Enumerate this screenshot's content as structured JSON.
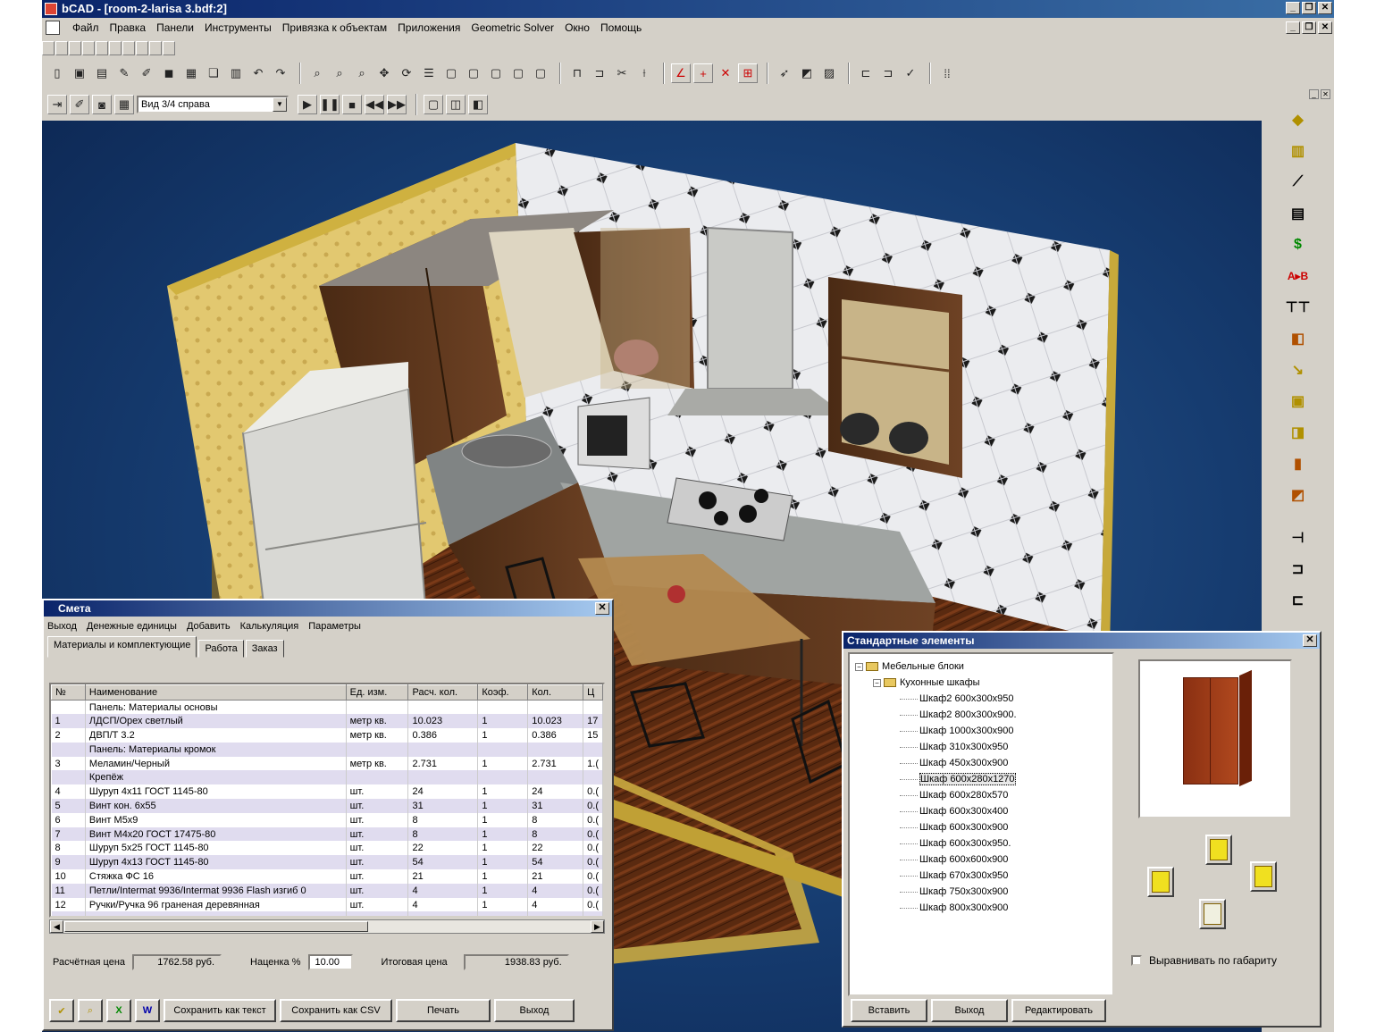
{
  "app": {
    "title": "bCAD - [room-2-larisa 3.bdf:2]",
    "menu": [
      "Файл",
      "Правка",
      "Панели",
      "Инструменты",
      "Привязка к объектам",
      "Приложения",
      "Geometric Solver",
      "Окно",
      "Помощь"
    ]
  },
  "view_toolbar": {
    "view_combo": "Вид 3/4 справа"
  },
  "estimate": {
    "title": "Смета",
    "menu": [
      "Выход",
      "Денежные единицы",
      "Добавить",
      "Калькуляция",
      "Параметры"
    ],
    "tabs": [
      "Материалы и комплектующие",
      "Работа",
      "Заказ"
    ],
    "columns": [
      "№",
      "Наименование",
      "Ед. изм.",
      "Расч. кол.",
      "Коэф.",
      "Кол.",
      "Ц"
    ],
    "rows": [
      {
        "n": "",
        "name": "Панель: Материалы основы",
        "unit": "",
        "calc": "",
        "coef": "",
        "qty": "",
        "price": "",
        "kind": "grp"
      },
      {
        "n": "1",
        "name": "ЛДСП/Орех светлый",
        "unit": "метр кв.",
        "calc": "10.023",
        "coef": "1",
        "qty": "10.023",
        "price": "17",
        "kind": "alt"
      },
      {
        "n": "2",
        "name": "ДВП/Т 3.2",
        "unit": "метр кв.",
        "calc": "0.386",
        "coef": "1",
        "qty": "0.386",
        "price": "15",
        "kind": ""
      },
      {
        "n": "",
        "name": "Панель: Материалы кромок",
        "unit": "",
        "calc": "",
        "coef": "",
        "qty": "",
        "price": "",
        "kind": "alt"
      },
      {
        "n": "3",
        "name": "Меламин/Черный",
        "unit": "метр кв.",
        "calc": "2.731",
        "coef": "1",
        "qty": "2.731",
        "price": "1.(",
        "kind": ""
      },
      {
        "n": "",
        "name": "Крепёж",
        "unit": "",
        "calc": "",
        "coef": "",
        "qty": "",
        "price": "",
        "kind": "alt"
      },
      {
        "n": "4",
        "name": "Шуруп 4x11 ГОСТ 1145-80",
        "unit": "шт.",
        "calc": "24",
        "coef": "1",
        "qty": "24",
        "price": "0.(",
        "kind": ""
      },
      {
        "n": "5",
        "name": "Винт кон. 6x55",
        "unit": "шт.",
        "calc": "31",
        "coef": "1",
        "qty": "31",
        "price": "0.(",
        "kind": "alt"
      },
      {
        "n": "6",
        "name": "Винт М5x9",
        "unit": "шт.",
        "calc": "8",
        "coef": "1",
        "qty": "8",
        "price": "0.(",
        "kind": ""
      },
      {
        "n": "7",
        "name": "Винт М4x20 ГОСТ 17475-80",
        "unit": "шт.",
        "calc": "8",
        "coef": "1",
        "qty": "8",
        "price": "0.(",
        "kind": "alt"
      },
      {
        "n": "8",
        "name": "Шуруп 5x25 ГОСТ 1145-80",
        "unit": "шт.",
        "calc": "22",
        "coef": "1",
        "qty": "22",
        "price": "0.(",
        "kind": ""
      },
      {
        "n": "9",
        "name": "Шуруп 4x13 ГОСТ 1145-80",
        "unit": "шт.",
        "calc": "54",
        "coef": "1",
        "qty": "54",
        "price": "0.(",
        "kind": "alt"
      },
      {
        "n": "10",
        "name": "Стяжка ФС 16",
        "unit": "шт.",
        "calc": "21",
        "coef": "1",
        "qty": "21",
        "price": "0.(",
        "kind": ""
      },
      {
        "n": "11",
        "name": "Петли/Intermat 9936/Intermat 9936 Flash изгиб 0",
        "unit": "шт.",
        "calc": "4",
        "coef": "1",
        "qty": "4",
        "price": "0.(",
        "kind": "alt"
      },
      {
        "n": "12",
        "name": "Ручки/Ручка 96 граненая деревянная",
        "unit": "шт.",
        "calc": "4",
        "coef": "1",
        "qty": "4",
        "price": "0.(",
        "kind": ""
      },
      {
        "n": "",
        "name": "",
        "unit": "",
        "calc": "",
        "coef": "",
        "qty": "",
        "price": "",
        "kind": "alt"
      }
    ],
    "calc_price_label": "Расчётная цена",
    "calc_price": "1762.58 руб.",
    "markup_label": "Наценка %",
    "markup": "10.00",
    "total_label": "Итоговая цена",
    "total": "1938.83 руб.",
    "buttons": [
      "Сохранить как текст",
      "Сохранить как CSV",
      "Печать",
      "Выход"
    ]
  },
  "std": {
    "title": "Стандартные элементы",
    "tree_root": "Мебельные блоки",
    "tree_child": "Кухонные шкафы",
    "items": [
      "Шкаф2 600x300x950",
      "Шкаф2 800x300x900.",
      "Шкаф 1000x300x900",
      "Шкаф 310x300x950",
      "Шкаф 450x300x900",
      "Шкаф 600x280x1270",
      "Шкаф 600x280x570",
      "Шкаф 600x300x400",
      "Шкаф 600x300x900",
      "Шкаф 600x300x950.",
      "Шкаф 600x600x900",
      "Шкаф 670x300x950",
      "Шкаф 750x300x900",
      "Шкаф 800x300x900"
    ],
    "selected_index": 5,
    "align_label": "Выравнивать по габариту",
    "buttons": [
      "Вставить",
      "Выход",
      "Редактировать"
    ]
  },
  "colors": {
    "title_blue": "#0a246a",
    "viewport_blue": "#1c4a82",
    "face": "#d4d0c8"
  },
  "icons": {
    "tools": [
      "new-icon",
      "open-icon",
      "save-icon",
      "undo-icon",
      "redo-icon",
      "zoom-icon",
      "pan-icon",
      "cube-icon",
      "grid-icon"
    ]
  }
}
